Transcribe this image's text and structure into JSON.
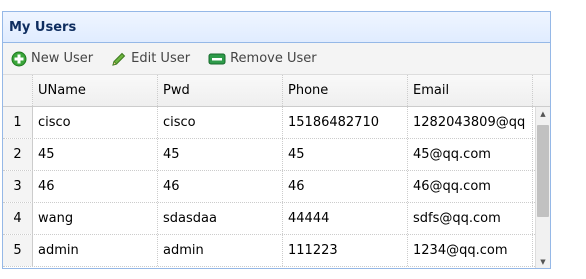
{
  "panel": {
    "title": "My Users"
  },
  "toolbar": {
    "new_label": "New User",
    "edit_label": "Edit User",
    "remove_label": "Remove User"
  },
  "grid": {
    "columns": [
      "UName",
      "Pwd",
      "Phone",
      "Email"
    ],
    "rows": [
      {
        "rownum": "1",
        "uname": "cisco",
        "pwd": "cisco",
        "phone": "15186482710",
        "email": "1282043809@qq"
      },
      {
        "rownum": "2",
        "uname": "45",
        "pwd": "45",
        "phone": "45",
        "email": "45@qq.com"
      },
      {
        "rownum": "3",
        "uname": "46",
        "pwd": "46",
        "phone": "46",
        "email": "46@qq.com"
      },
      {
        "rownum": "4",
        "uname": "wang",
        "pwd": "sdasdaa",
        "phone": "44444",
        "email": "sdfs@qq.com"
      },
      {
        "rownum": "5",
        "uname": "admin",
        "pwd": "admin",
        "phone": "111223",
        "email": "1234@qq.com"
      }
    ]
  },
  "colors": {
    "panel_border": "#95b8e7",
    "title_text": "#0e2d5f",
    "add_icon": "#2e9b2e",
    "edit_icon": "#4a9a2a",
    "remove_icon": "#1f8f3a"
  },
  "icons": {
    "new": "plus-circle-icon",
    "edit": "pencil-icon",
    "remove": "minus-box-icon"
  }
}
